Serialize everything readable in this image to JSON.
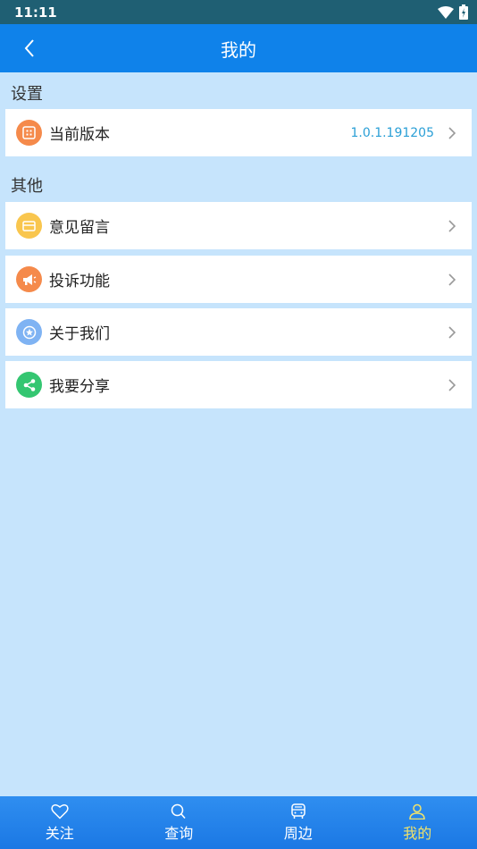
{
  "status_bar": {
    "time": "11:11"
  },
  "header": {
    "title": "我的"
  },
  "sections": {
    "settings": {
      "title": "设置"
    },
    "other": {
      "title": "其他"
    }
  },
  "rows": {
    "version": {
      "label": "当前版本",
      "value": "1.0.1.191205",
      "icon": "app-grid-icon",
      "icon_color": "#f58a4b"
    },
    "feedback": {
      "label": "意见留言",
      "icon": "card-icon",
      "icon_color": "#f9c64e"
    },
    "complaint": {
      "label": "投诉功能",
      "icon": "megaphone-icon",
      "icon_color": "#f58a4b"
    },
    "about": {
      "label": "关于我们",
      "icon": "star-badge-icon",
      "icon_color": "#7fb3f3"
    },
    "share": {
      "label": "我要分享",
      "icon": "share-icon",
      "icon_color": "#34c671"
    }
  },
  "tabs": [
    {
      "label": "关注",
      "icon": "heart-icon"
    },
    {
      "label": "查询",
      "icon": "search-icon"
    },
    {
      "label": "周边",
      "icon": "bus-icon"
    },
    {
      "label": "我的",
      "icon": "person-icon",
      "active": true
    }
  ],
  "colors": {
    "appbar": "#0f82ea",
    "background": "#c6e4fc",
    "active_tab": "#f2e36a",
    "value_text": "#2a9fd6"
  }
}
